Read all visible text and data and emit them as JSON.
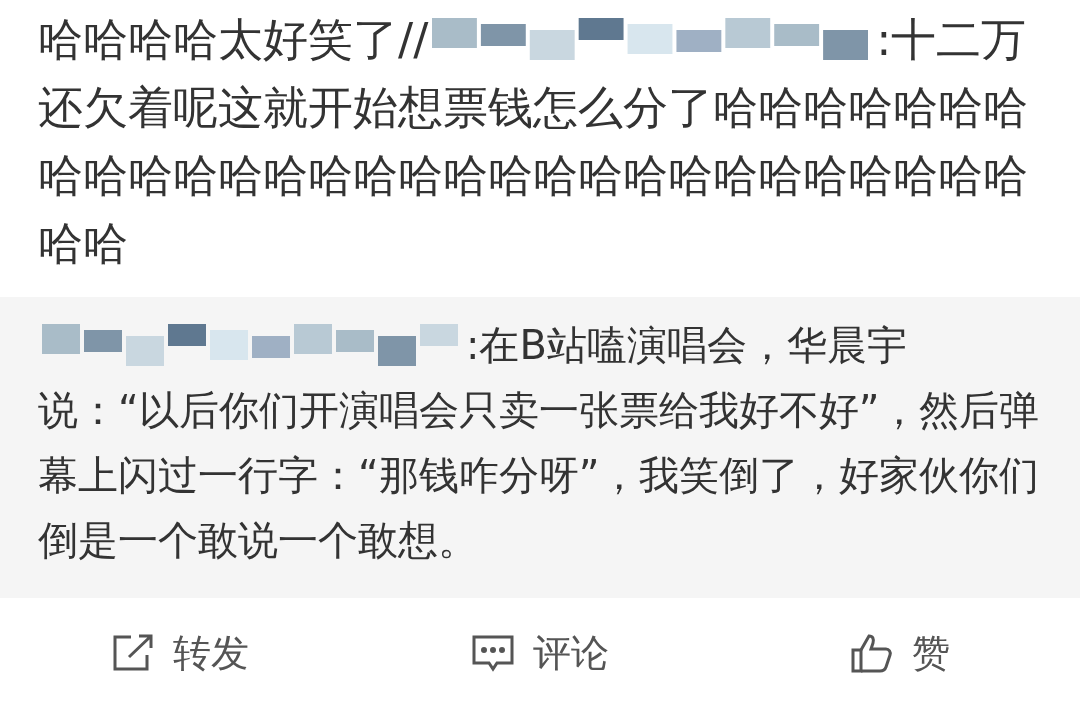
{
  "post": {
    "text_before": "哈哈哈哈太好笑了//",
    "name_suffix": ":十二万",
    "text_rest": "还欠着呢这就开始想票钱怎么分了哈哈哈哈哈哈哈哈哈哈哈哈哈哈哈哈哈哈哈哈哈哈哈哈哈哈哈哈哈哈哈"
  },
  "quoted": {
    "name_suffix": ":在B站嗑演唱会，华晨宇",
    "text_rest": "说：“以后你们开演唱会只卖一张票给我好不好”，然后弹幕上闪过一行字：“那钱咋分呀”，我笑倒了，好家伙你们倒是一个敢说一个敢想。"
  },
  "actions": [
    {
      "kind": "share",
      "label": "转发"
    },
    {
      "kind": "comment",
      "label": "评论"
    },
    {
      "kind": "like",
      "label": "赞"
    }
  ]
}
